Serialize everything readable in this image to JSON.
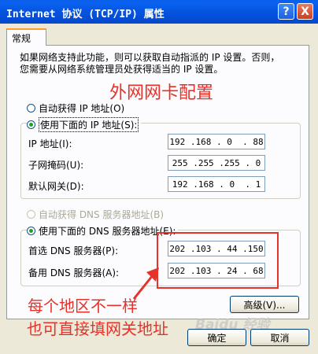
{
  "window": {
    "title": "Internet 协议 (TCP/IP) 属性",
    "help_label": "?",
    "close_label": "X"
  },
  "tab": {
    "label": "常规"
  },
  "description": [
    "如果网络支持此功能，则可以获取自动指派的 IP 设置。否则，",
    "您需要从网络系统管理员处获得适当的 IP 设置。"
  ],
  "annotations": {
    "top": "外网网卡配置",
    "bottom_line1": "每个地区不一样",
    "bottom_line2": "也可直接填网关地址"
  },
  "ip_section": {
    "auto_radio_label": "自动获得 IP 地址(O)",
    "manual_radio_label": "使用下面的 IP 地址(S):",
    "selected": "manual",
    "fields": [
      {
        "label": "IP 地址(I):",
        "value": "192 .168 . 0  . 88"
      },
      {
        "label": "子网掩码(U):",
        "value": "255 .255 .255 . 0"
      },
      {
        "label": "默认网关(D):",
        "value": "192 .168 . 0  . 1"
      }
    ]
  },
  "dns_section": {
    "auto_radio_label": "自动获得 DNS 服务器地址(B)",
    "manual_radio_label": "使用下面的 DNS 服务器地址(E):",
    "selected": "manual",
    "fields": [
      {
        "label": "首选 DNS 服务器(P):",
        "value": "202 .103 . 44 .150"
      },
      {
        "label": "备用 DNS 服务器(A):",
        "value": "202 .103 . 24 . 68"
      }
    ]
  },
  "buttons": {
    "advanced": "高级(V)...",
    "ok": "确定",
    "cancel": "取消"
  },
  "watermark": "Baidu 经验",
  "colors": {
    "annotation": "#e5322a",
    "titlebar": "#0554e0"
  }
}
